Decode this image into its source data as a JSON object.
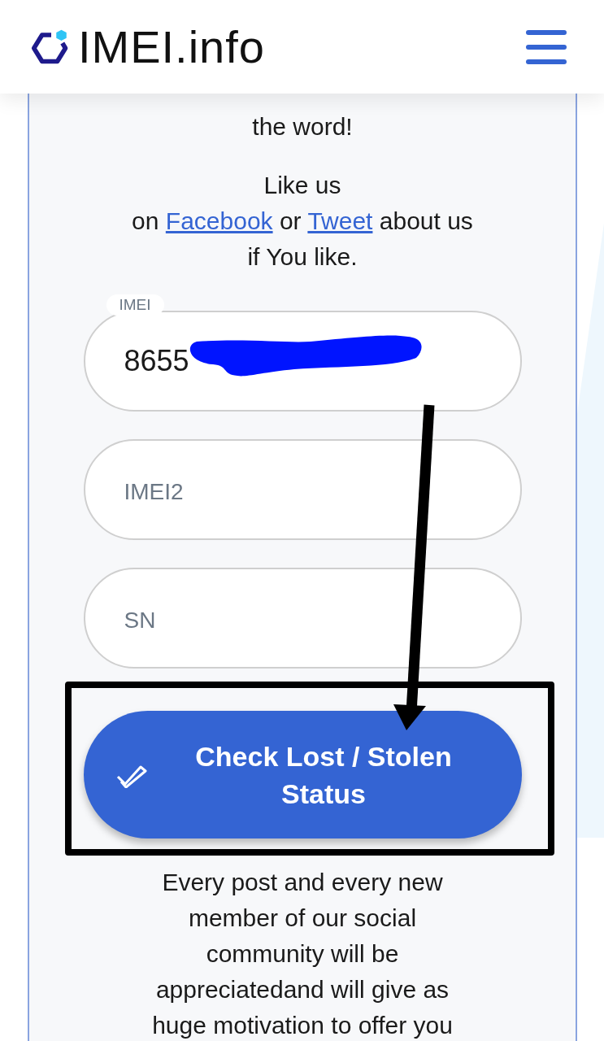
{
  "header": {
    "logo_text": "IMEI.info"
  },
  "intro": {
    "lines": [
      "the word!"
    ]
  },
  "share": {
    "lines": [
      [
        {
          "text": "Like us"
        }
      ],
      [
        {
          "text": "on "
        },
        {
          "text": "Facebook",
          "kind": "link"
        },
        {
          "text": " or "
        },
        {
          "text": "Tweet",
          "kind": "link"
        },
        {
          "text": " about us"
        }
      ],
      [
        {
          "text": "if You like."
        }
      ]
    ]
  },
  "fields": [
    {
      "label": "IMEI",
      "value": "8655"
    },
    {
      "placeholder": "IMEI2"
    },
    {
      "placeholder": "SN"
    }
  ],
  "button": {
    "label": "Check Lost / Stolen Status"
  },
  "footer": {
    "lines": [
      "Every post and every new",
      "member of our social",
      "community will be",
      "appreciatedand will give as",
      "huge motivation to offer you"
    ]
  }
}
